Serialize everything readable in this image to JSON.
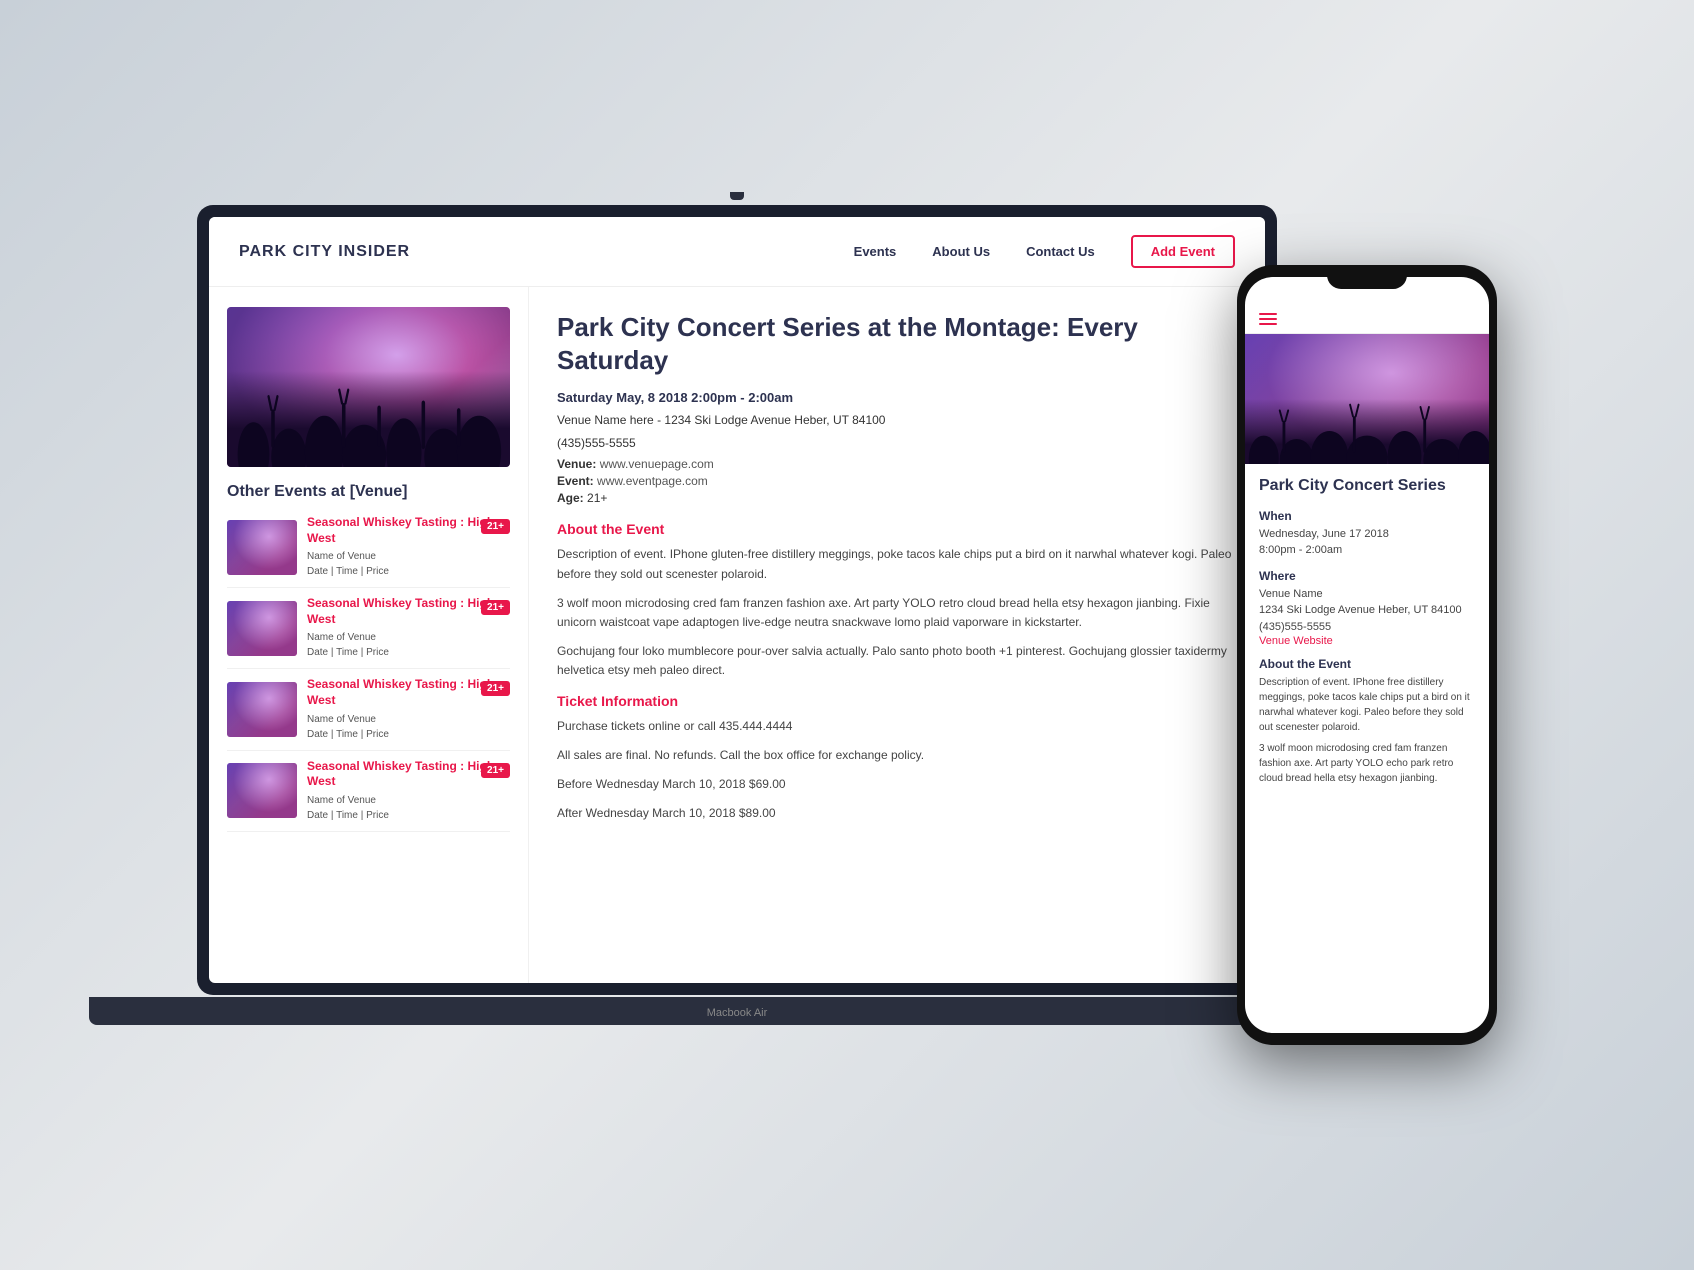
{
  "site": {
    "logo": "PARK CITY INSIDER",
    "nav": {
      "events": "Events",
      "about": "About Us",
      "contact": "Contact Us",
      "add_event": "Add Event"
    }
  },
  "sidebar": {
    "hero_alt": "Concert crowd with smoke",
    "section_title": "Other Events at [Venue]",
    "events": [
      {
        "title": "Seasonal Whiskey Tasting : High West",
        "venue": "Name of Venue",
        "meta": "Date  |  Time  |  Price",
        "badge": "21+"
      },
      {
        "title": "Seasonal Whiskey Tasting : High West",
        "venue": "Name of Venue",
        "meta": "Date  |  Time  |  Price",
        "badge": "21+"
      },
      {
        "title": "Seasonal Whiskey Tasting : High West",
        "venue": "Name of Venue",
        "meta": "Date  |  Time  |  Price",
        "badge": "21+"
      },
      {
        "title": "Seasonal Whiskey Tasting : High West",
        "venue": "Name of Venue",
        "meta": "Date  |  Time  |  Price",
        "badge": "21+"
      }
    ]
  },
  "main": {
    "event_title": "Park City Concert Series at the Montage: Every Saturday",
    "date_line": "Saturday May, 8 2018   2:00pm - 2:00am",
    "location_line1": "Venue Name here - 1234 Ski Lodge Avenue Heber, UT 84100",
    "location_line2": "(435)555-5555",
    "venue_label": "Venue:",
    "venue_url": "www.venuepage.com",
    "event_label": "Event:",
    "event_url": "www.eventpage.com",
    "age_label": "Age:",
    "age_value": "21+",
    "about_heading": "About the Event",
    "about_p1": "Description of event. IPhone gluten-free distillery meggings, poke tacos kale chips put a bird on it narwhal whatever kogi. Paleo before they sold out scenester polaroid.",
    "about_p2": "3 wolf moon microdosing cred fam franzen fashion axe. Art party YOLO retro cloud bread hella etsy hexagon jianbing. Fixie unicorn waistcoat vape adaptogen live-edge neutra snackwave lomo plaid vaporware in kickstarter.",
    "about_p3": "Gochujang four loko mumblecore pour-over salvia actually. Palo santo photo booth +1 pinterest. Gochujang glossier taxidermy helvetica etsy meh paleo direct.",
    "ticket_heading": "Ticket Information",
    "ticket_line1": "Purchase tickets online or call 435.444.4444",
    "ticket_line2": "All sales are final. No refunds. Call the box office for exchange policy.",
    "price_before": "Before Wednesday March 10, 2018 $69.00",
    "price_after": "After Wednesday March 10, 2018 $89.00"
  },
  "phone": {
    "event_title": "Park City Concert Series",
    "when_label": "When",
    "when_date": "Wednesday, June 17 2018",
    "when_time": "8:00pm - 2:00am",
    "where_label": "Where",
    "where_name": "Venue Name",
    "where_address": "1234 Ski Lodge Avenue Heber, UT 84100",
    "where_phone": "(435)555-5555",
    "where_website": "Venue Website",
    "about_label": "About the Event",
    "about_p1": "Description of event. IPhone free distillery meggings, poke tacos kale chips put a bird on it narwhal whatever kogi. Paleo before they sold out scenester polaroid.",
    "about_p2": "3 wolf moon microdosing cred fam franzen fashion axe. Art party YOLO echo park retro cloud bread hella etsy hexagon jianbing."
  },
  "laptop_label": "Macbook Air",
  "colors": {
    "brand_dark": "#2d3250",
    "accent": "#e8174a",
    "text_muted": "#555"
  }
}
